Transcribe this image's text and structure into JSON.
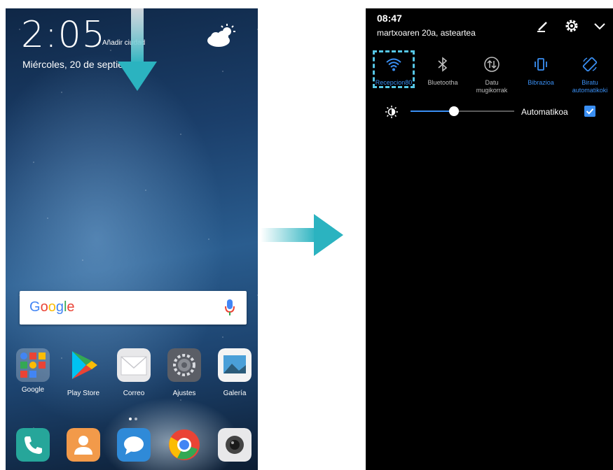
{
  "home": {
    "time": "2:05",
    "add_city": "Añadir ciudad",
    "date": "Miércoles, 20 de septiembre",
    "search_logo": [
      "G",
      "o",
      "o",
      "g",
      "l",
      "e"
    ],
    "apps": [
      {
        "label": "Google"
      },
      {
        "label": "Play Store"
      },
      {
        "label": "Correo"
      },
      {
        "label": "Ajustes"
      },
      {
        "label": "Galería"
      }
    ],
    "dock": [
      "phone-icon",
      "contacts-icon",
      "messages-icon",
      "chrome-icon",
      "camera-icon"
    ]
  },
  "panel": {
    "time": "08:47",
    "date": "martxoaren 20a, asteartea",
    "header_icons": [
      "edit-icon",
      "settings-gear-icon",
      "chevron-down-icon"
    ],
    "toggles": [
      {
        "label": "Recepcion80",
        "icon": "wifi-icon",
        "active": true
      },
      {
        "label": "Bluetootha",
        "icon": "bluetooth-icon",
        "active": false
      },
      {
        "label": "Datu mugikorrak",
        "icon": "mobile-data-icon",
        "active": false
      },
      {
        "label": "Bibrazioa",
        "icon": "vibration-icon",
        "active": true
      },
      {
        "label": "Biratu automatikoki",
        "icon": "auto-rotate-icon",
        "active": true
      }
    ],
    "brightness": {
      "level": 0.42,
      "auto_label": "Automatikoa",
      "auto_checked": true
    }
  },
  "colors": {
    "accent_blue": "#3a8ff3",
    "arrow_teal": "#2bb3c0",
    "focus_dashed": "#56c7e6",
    "google_blue": "#4285f4",
    "google_red": "#ea4335",
    "google_yellow": "#fbbc05",
    "google_green": "#34a853"
  }
}
